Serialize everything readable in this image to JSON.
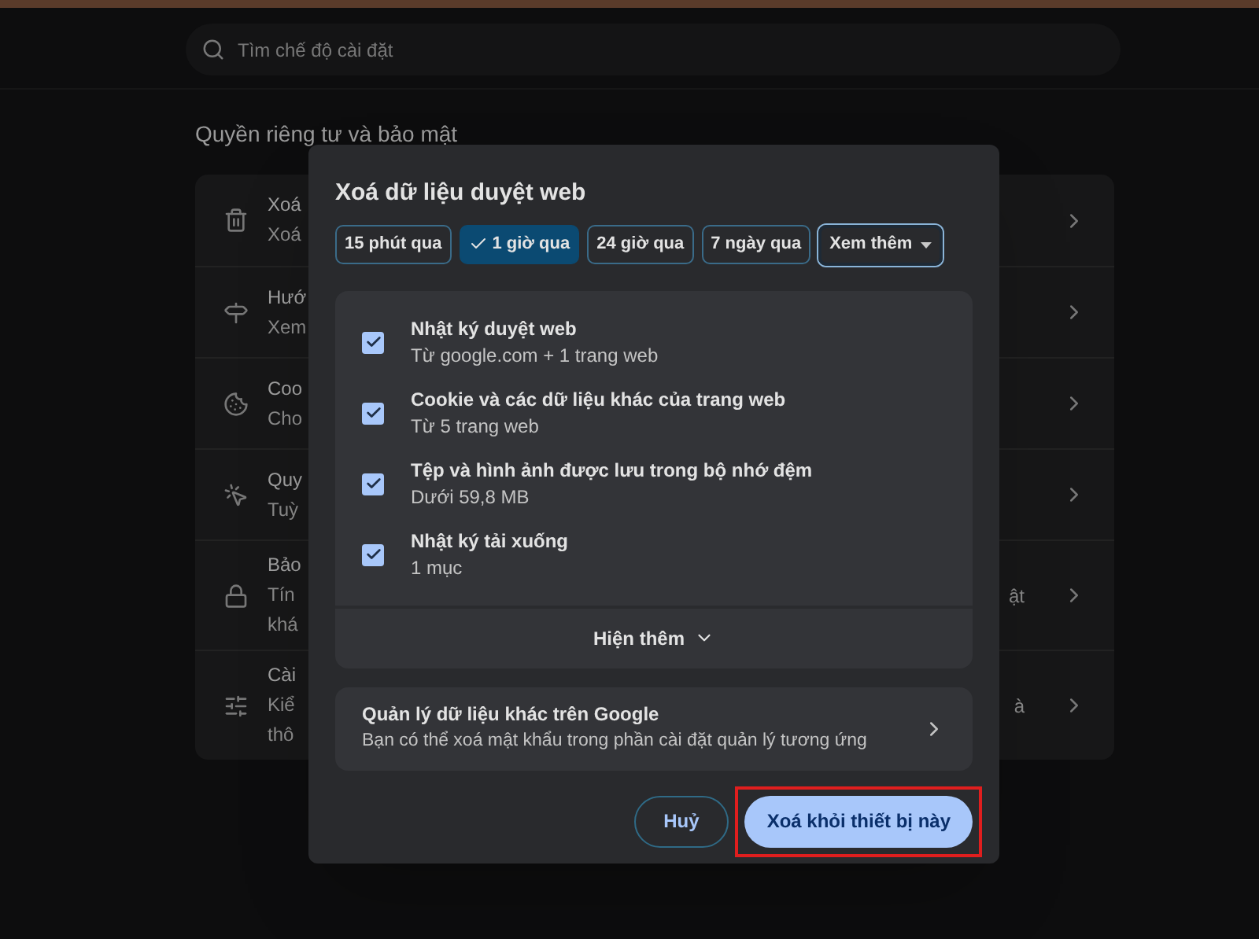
{
  "search": {
    "placeholder": "Tìm chế độ cài đặt"
  },
  "section_title": "Quyền riêng tư và bảo mật",
  "settings_rows": [
    {
      "lines": [
        "Xoá",
        "Xoá"
      ]
    },
    {
      "lines": [
        "Hướ",
        "Xem"
      ]
    },
    {
      "lines": [
        "Coo",
        "Cho"
      ]
    },
    {
      "lines": [
        "Quy",
        "Tuỳ"
      ]
    },
    {
      "lines": [
        "Bảo",
        "Tín",
        "khá"
      ],
      "trailing": "ật"
    },
    {
      "lines": [
        "Cài",
        "Kiể",
        "thô"
      ],
      "trailing": "à"
    }
  ],
  "dialog": {
    "title": "Xoá dữ liệu duyệt web",
    "time_ranges": [
      {
        "label": "15 phút qua",
        "selected": false,
        "kind": "chip"
      },
      {
        "label": "1 giờ qua",
        "selected": true,
        "kind": "chip"
      },
      {
        "label": "24 giờ qua",
        "selected": false,
        "kind": "chip"
      },
      {
        "label": "7 ngày qua",
        "selected": false,
        "kind": "chip"
      },
      {
        "label": "Xem thêm",
        "selected": false,
        "kind": "dropdown"
      }
    ],
    "data_types": [
      {
        "label": "Nhật ký duyệt web",
        "detail": "Từ google.com + 1 trang web",
        "checked": true
      },
      {
        "label": "Cookie và các dữ liệu khác của trang web",
        "detail": "Từ 5 trang web",
        "checked": true
      },
      {
        "label": "Tệp và hình ảnh được lưu trong bộ nhớ đệm",
        "detail": "Dưới 59,8 MB",
        "checked": true
      },
      {
        "label": "Nhật ký tải xuống",
        "detail": "1 mục",
        "checked": true
      }
    ],
    "show_more": "Hiện thêm",
    "google_card": {
      "title": "Quản lý dữ liệu khác trên Google",
      "detail": "Bạn có thể xoá mật khẩu trong phần cài đặt quản lý tương ứng"
    },
    "buttons": [
      {
        "label": "Huỷ",
        "kind": "secondary",
        "highlighted": false
      },
      {
        "label": "Xoá khỏi thiết bị này",
        "kind": "primary",
        "highlighted": true
      }
    ]
  }
}
